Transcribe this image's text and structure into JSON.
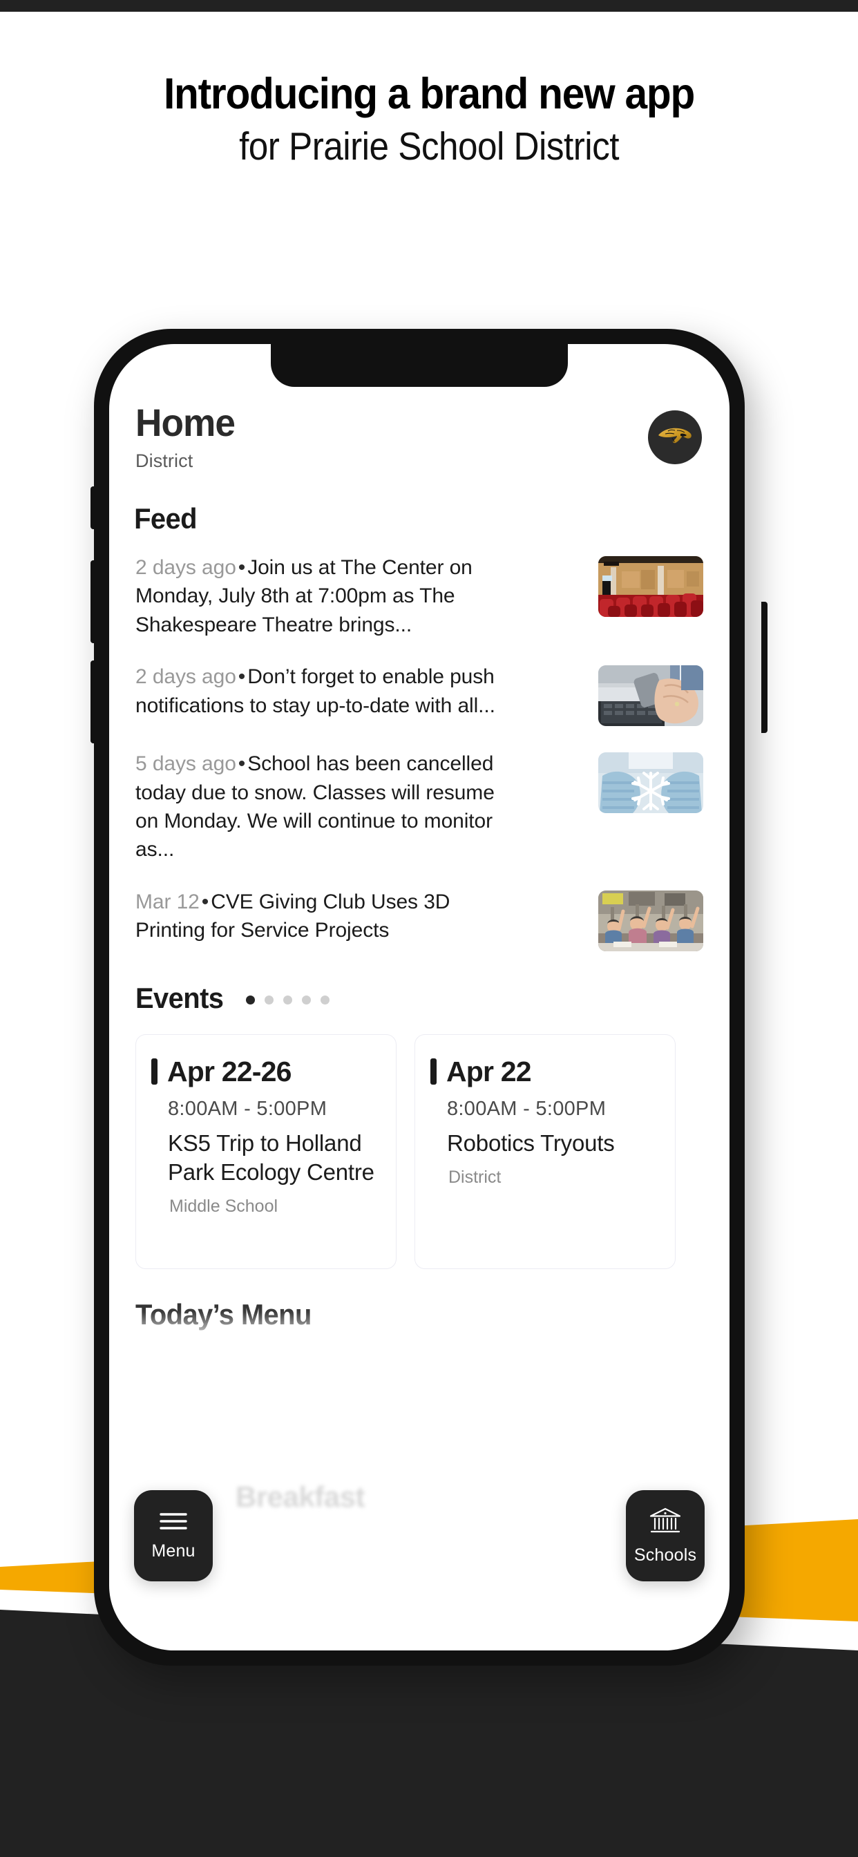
{
  "hero": {
    "line1": "Introducing a brand new app",
    "line2": "for Prairie School District"
  },
  "colors": {
    "accent_yellow": "#F5A800",
    "dark": "#222222",
    "page_bg": "#FFFFFF",
    "muted_text": "#999999",
    "body_text": "#1B1B1B",
    "card_border": "#ECECF3"
  },
  "app": {
    "header": {
      "title": "Home",
      "subtitle": "District",
      "avatar_icon": "panther-mascot-logo"
    },
    "feed": {
      "heading": "Feed",
      "items": [
        {
          "age": "2 days ago",
          "separator": "•",
          "text": "Join us at The Center on Monday, July 8th at 7:00pm as The Shakespeare Theatre brings...",
          "thumb": "theatre-seats-photo"
        },
        {
          "age": "2 days ago",
          "separator": "•",
          "text": "Don’t forget to enable push notifications to stay up-to-date with all...",
          "thumb": "hands-phone-laptop-photo"
        },
        {
          "age": "5 days ago",
          "separator": "•",
          "text": "School has been cancelled today due to snow. Classes will resume on Monday. We will continue to monitor as...",
          "thumb": "snowflake-mittens-photo"
        },
        {
          "age": "Mar 12",
          "separator": "•",
          "text": "CVE Giving Club Uses 3D Printing for Service Projects",
          "thumb": "classroom-students-photo"
        }
      ]
    },
    "events": {
      "heading": "Events",
      "dots_total": 5,
      "dots_active_index": 0,
      "cards": [
        {
          "date": "Apr 22-26",
          "time": "8:00AM  -  5:00PM",
          "title": "KS5 Trip to Holland Park Ecology Centre",
          "scope": "Middle School"
        },
        {
          "date": "Apr 22",
          "time": "8:00AM  -  5:00PM",
          "title": "Robotics Tryouts",
          "scope": "District"
        }
      ]
    },
    "menu": {
      "heading": "Today’s Menu",
      "ghost_label": "Breakfast"
    },
    "fabs": [
      {
        "label": "Menu",
        "icon": "hamburger-menu-icon"
      },
      {
        "label": "Schools",
        "icon": "school-building-icon"
      }
    ]
  }
}
